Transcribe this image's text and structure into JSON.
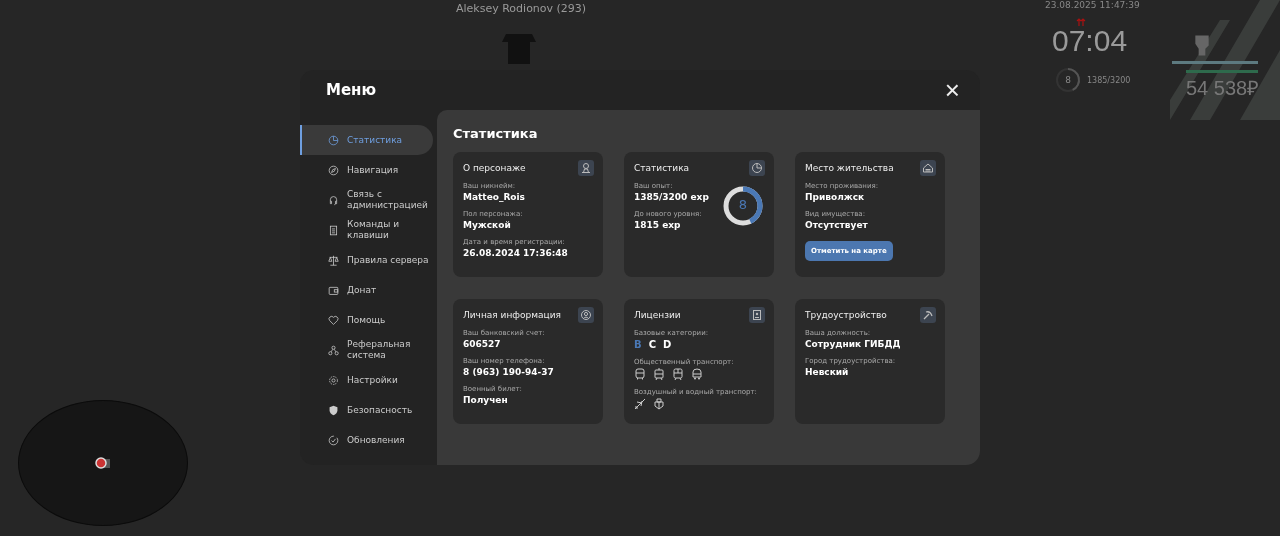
{
  "scene": {
    "player_tag": "Aleksey Rodionov (293)"
  },
  "hud": {
    "datetime": "23.08.2025 11:47:39",
    "clock": "07:04",
    "level_number": "8",
    "xp": "1385/3200",
    "level": 0.43,
    "money": "54 538₽"
  },
  "menu": {
    "title": "Меню",
    "close": "×",
    "sidebar": [
      {
        "label": "Статистика",
        "selected": true
      },
      {
        "label": "Навигация",
        "selected": false
      },
      {
        "label": "Связь с администрацией",
        "selected": false
      },
      {
        "label": "Команды и клавиши",
        "selected": false
      },
      {
        "label": "Правила сервера",
        "selected": false
      },
      {
        "label": "Донат",
        "selected": false
      },
      {
        "label": "Помощь",
        "selected": false
      },
      {
        "label": "Реферальная система",
        "selected": false
      },
      {
        "label": "Настройки",
        "selected": false
      },
      {
        "label": "Безопасность",
        "selected": false
      },
      {
        "label": "Обновления",
        "selected": false
      }
    ],
    "section_title": "Статистика",
    "cards": [
      {
        "kind": "fields",
        "title": "О персонаже",
        "fields": [
          {
            "label": "Ваш никнейм:",
            "value": "Matteo_Rois"
          },
          {
            "label": "Пол персонажа:",
            "value": "Мужской"
          },
          {
            "label": "Дата и время регистрации:",
            "value": "26.08.2024 17:36:48"
          }
        ]
      },
      {
        "kind": "progress",
        "title": "Статистика",
        "fields": [
          {
            "label": "Ваш опыт:",
            "value": "1385/3200 exp"
          },
          {
            "label": "До нового уровня:",
            "value": "1815 exp"
          }
        ],
        "level_number": "8",
        "level": 0.43
      },
      {
        "kind": "residence",
        "title": "Место жительства",
        "fields": [
          {
            "label": "Место проживания:",
            "value": "Приволжск"
          },
          {
            "label": "Вид имущества:",
            "value": "Отсутствует"
          }
        ],
        "button": "Отметить на карте"
      },
      {
        "kind": "fields",
        "title": "Личная информация",
        "fields": [
          {
            "label": "Ваш банковский счет:",
            "value": "606527"
          },
          {
            "label": "Ваш номер телефона:",
            "value": "8 (963) 190-94-37"
          },
          {
            "label": "Военный билет:",
            "value": "Получен"
          }
        ]
      },
      {
        "kind": "licenses",
        "title": "Лицензии",
        "categories_label": "Базовые категории:",
        "categories": [
          {
            "text": "B",
            "highlighted": true
          },
          {
            "text": "C",
            "highlighted": false
          },
          {
            "text": "D",
            "highlighted": false
          }
        ],
        "public_label": "Общественный транспорт:",
        "air_label": "Воздушный и водный транспорт:"
      },
      {
        "kind": "fields",
        "title": "Трудоустройство",
        "fields": [
          {
            "label": "Ваша должность:",
            "value": "Сотрудник ГИБДД"
          },
          {
            "label": "Город трудоустройства:",
            "value": "Невский"
          }
        ]
      }
    ]
  }
}
